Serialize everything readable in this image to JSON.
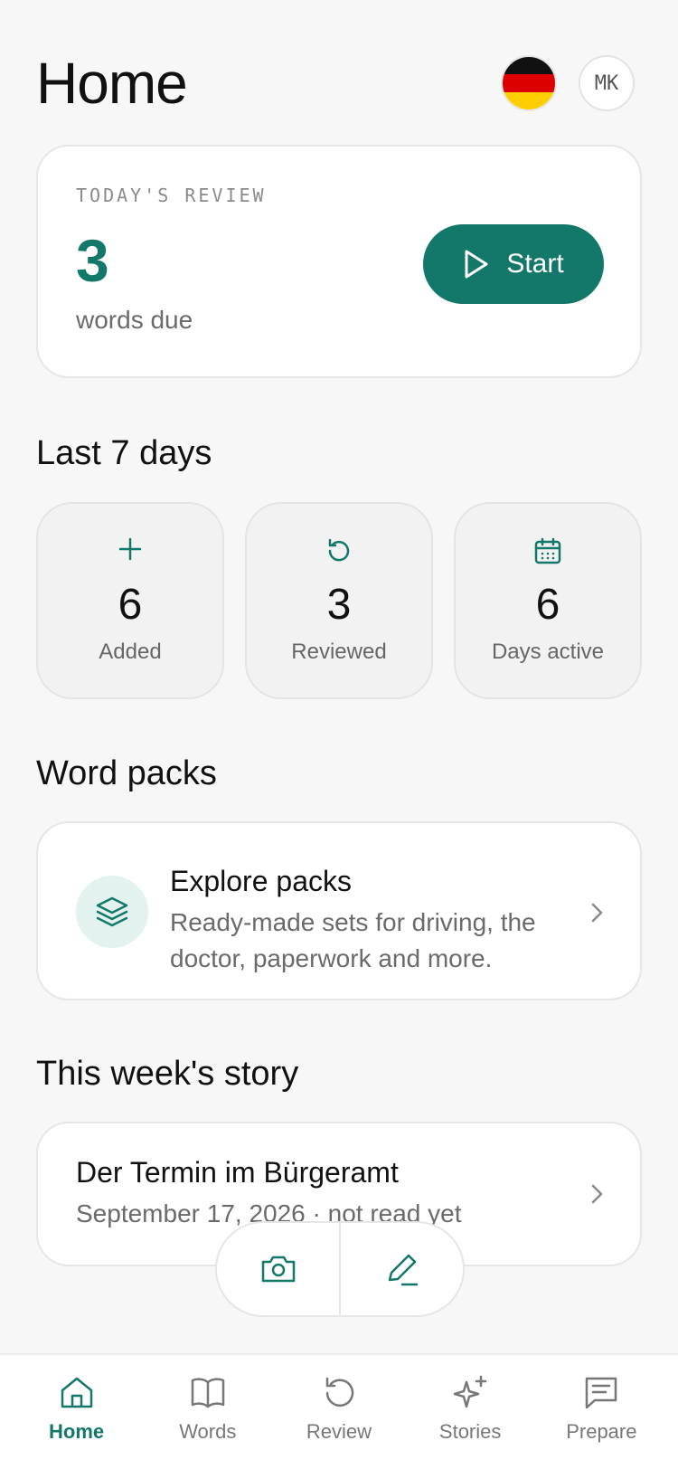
{
  "header": {
    "title": "Home",
    "language_flag": "germany-flag",
    "avatar_initials": "MK"
  },
  "review": {
    "eyebrow": "TODAY'S REVIEW",
    "count": "3",
    "subtitle": "words due",
    "start_label": "Start"
  },
  "stats": {
    "title": "Last 7 days",
    "items": [
      {
        "icon": "plus-icon",
        "value": "6",
        "label": "Added"
      },
      {
        "icon": "refresh-icon",
        "value": "3",
        "label": "Reviewed"
      },
      {
        "icon": "calendar-icon",
        "value": "6",
        "label": "Days active"
      }
    ]
  },
  "packs": {
    "section_title": "Word packs",
    "title": "Explore packs",
    "description": "Ready-made sets for driving, the doctor, paperwork and more."
  },
  "story": {
    "section_title": "This week's story",
    "title": "Der Termin im Bürgeramt",
    "meta": "September 17, 2026 · not read yet"
  },
  "fab": {
    "camera": "camera-icon",
    "write": "pencil-icon"
  },
  "tabs": [
    {
      "label": "Home",
      "icon": "home-icon",
      "active": true
    },
    {
      "label": "Words",
      "icon": "book-icon",
      "active": false
    },
    {
      "label": "Review",
      "icon": "refresh-icon",
      "active": false
    },
    {
      "label": "Stories",
      "icon": "sparkles-icon",
      "active": false
    },
    {
      "label": "Prepare",
      "icon": "message-icon",
      "active": false
    }
  ],
  "colors": {
    "accent": "#13786a",
    "accent_light": "#e4f2ef",
    "background": "#f7f7f7",
    "flag_black": "#111111",
    "flag_red": "#dd0000",
    "flag_gold": "#ffce00"
  }
}
